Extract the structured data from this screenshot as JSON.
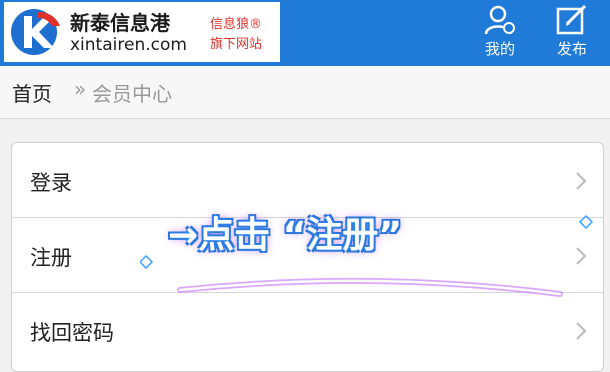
{
  "header": {
    "logo": {
      "cn": "新泰信息港",
      "en": "xintairen.com",
      "sub1": "信息狼®",
      "sub2": "旗下网站"
    },
    "nav": [
      {
        "label": "我的",
        "icon": "user-icon"
      },
      {
        "label": "发布",
        "icon": "edit-icon"
      }
    ]
  },
  "breadcrumb": {
    "home": "首页",
    "sep": "»",
    "current": "会员中心"
  },
  "menu": [
    {
      "label": "登录"
    },
    {
      "label": "注册"
    },
    {
      "label": "找回密码"
    }
  ],
  "overlay": {
    "text": "→点击 “注册”"
  },
  "colors": {
    "header_bg": "#1f7ad8",
    "logo_red": "#e0322b",
    "glow": "#3aa0ff"
  }
}
